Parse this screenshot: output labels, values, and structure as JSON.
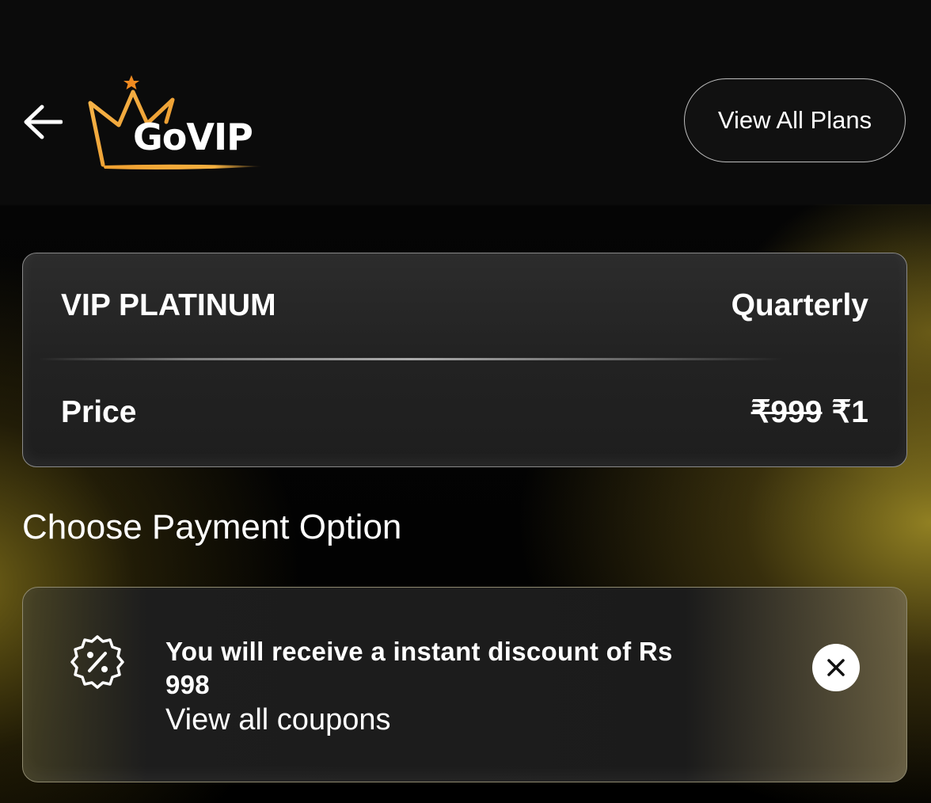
{
  "header": {
    "back_icon": "arrow-left-icon",
    "logo_text": "GoVIP",
    "view_all_plans_label": "View All Plans"
  },
  "plan": {
    "name": "VIP PLATINUM",
    "period": "Quarterly",
    "price_label": "Price",
    "original_price": "₹999",
    "current_price": "₹1"
  },
  "payment": {
    "section_title": "Choose Payment Option"
  },
  "coupon": {
    "icon": "discount-badge-icon",
    "message": "You will receive a instant discount of Rs 998",
    "link_label": "View all coupons",
    "close_icon": "close-icon"
  },
  "colors": {
    "background": "#000000",
    "header_background": "#0b0b0b",
    "card_background": "#222222",
    "logo_gold": "#f0a030",
    "text": "#ffffff"
  }
}
